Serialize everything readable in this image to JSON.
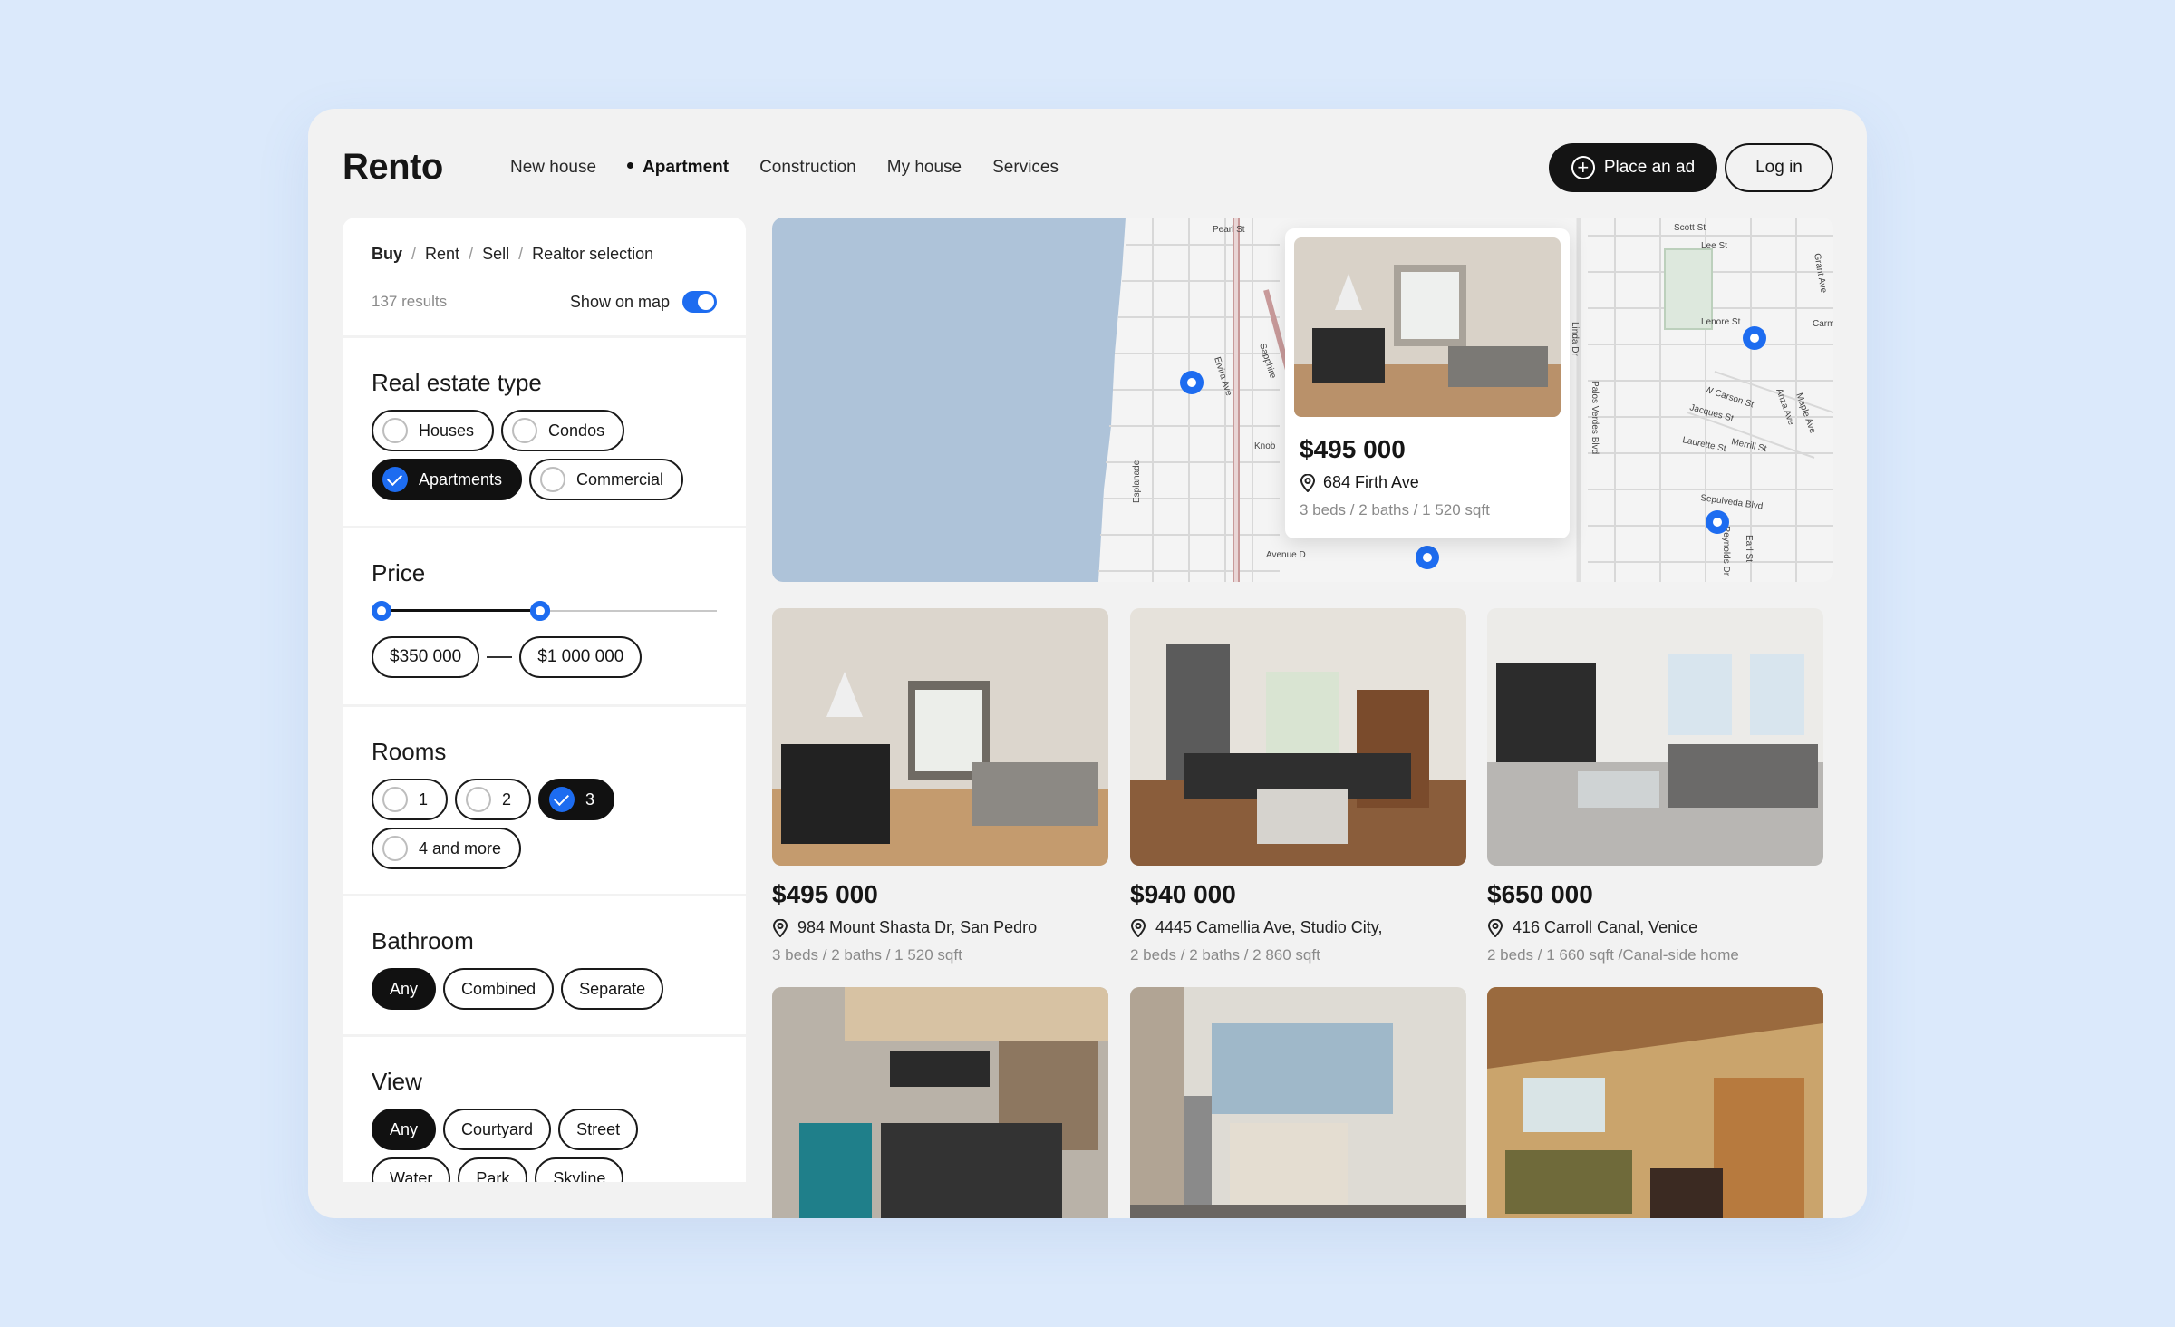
{
  "header": {
    "logo": "Rento",
    "nav": [
      "New house",
      "Apartment",
      "Construction",
      "My house",
      "Services"
    ],
    "nav_active": "Apartment",
    "place_ad": "Place an ad",
    "login": "Log in"
  },
  "filters": {
    "breadcrumbs": [
      "Buy",
      "Rent",
      "Sell",
      "Realtor selection"
    ],
    "results": "137 results",
    "show_on_map": "Show on map",
    "show_on_map_enabled": true,
    "real_estate": {
      "title": "Real estate type",
      "options": [
        "Houses",
        "Condos",
        "Apartments",
        "Commercial"
      ],
      "selected": "Apartments"
    },
    "price": {
      "title": "Price",
      "min": "$350 000",
      "max": "$1 000 000",
      "range_fraction": [
        0,
        0.46
      ]
    },
    "rooms": {
      "title": "Rooms",
      "options": [
        "1",
        "2",
        "3",
        "4 and more"
      ],
      "selected": "3"
    },
    "bathroom": {
      "title": "Bathroom",
      "options": [
        "Any",
        "Combined",
        "Separate"
      ],
      "selected": "Any"
    },
    "view": {
      "title": "View",
      "options": [
        "Any",
        "Courtyard",
        "Street",
        "Water",
        "Park",
        "Skyline"
      ],
      "selected": "Any"
    }
  },
  "map": {
    "streets": [
      "Pearl St",
      "Esplanade",
      "Elvira Ave",
      "Sapphire",
      "Knob",
      "Avenue D",
      "Linda Dr",
      "Palos Verdes Blvd",
      "Scott St",
      "Lee St",
      "Lenore St",
      "W Carson St",
      "Jacques St",
      "Laurette St",
      "Merrill St",
      "Sepulveda Blvd",
      "Grant Ave",
      "Anza Ave",
      "Maple Ave",
      "Reynolds Dr",
      "Earl St",
      "Carm"
    ],
    "popup": {
      "price": "$495 000",
      "address": "684 Firth Ave",
      "details": "3 beds / 2 baths / 1 520 sqft"
    }
  },
  "listings": [
    {
      "price": "$495 000",
      "address": "984 Mount Shasta Dr, San Pedro",
      "details": "3 beds / 2 baths / 1 520 sqft"
    },
    {
      "price": "$940 000",
      "address": "4445 Camellia Ave, Studio City,",
      "details": "2 beds / 2 baths / 2 860 sqft"
    },
    {
      "price": "$650 000",
      "address": "416 Carroll Canal, Venice",
      "details": "2 beds / 1 660 sqft /Canal-side home"
    },
    {
      "price": "",
      "address": "",
      "details": ""
    },
    {
      "price": "",
      "address": "",
      "details": ""
    },
    {
      "price": "",
      "address": "",
      "details": ""
    }
  ],
  "colors": {
    "accent": "#1d6cf0",
    "dark": "#141414",
    "background": "#dbe9fb",
    "panel": "#f2f2f2",
    "water": "#aec3d9"
  }
}
